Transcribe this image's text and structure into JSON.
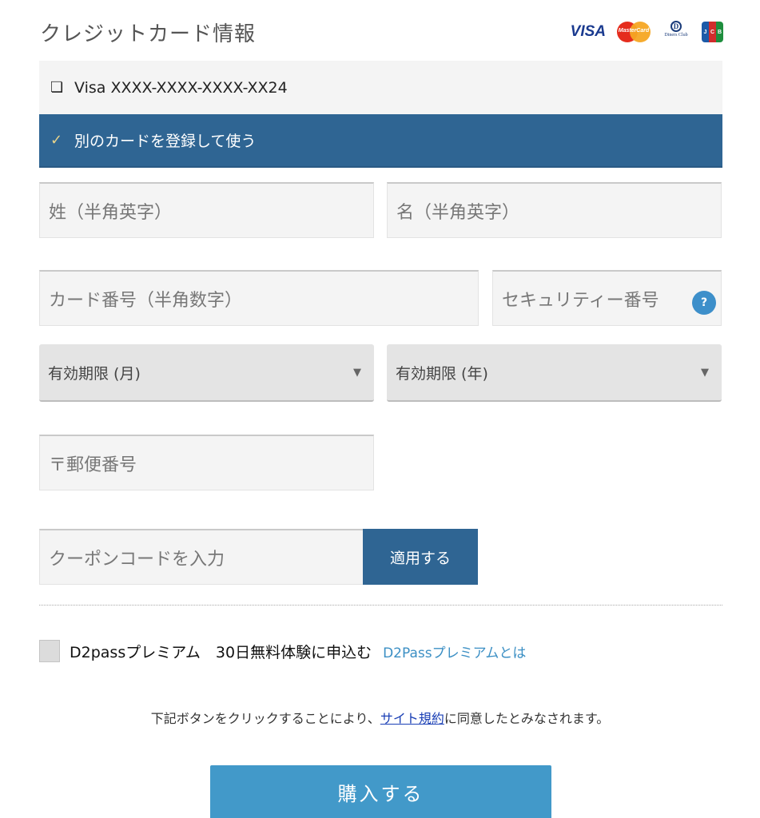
{
  "header": {
    "title": "クレジットカード情報",
    "brands": [
      "VISA",
      "MasterCard",
      "Diners Club International",
      "JCB"
    ]
  },
  "card_options": [
    {
      "icon": "checkbox-icon",
      "label": "Visa XXXX-XXXX-XXXX-XX24",
      "selected": false
    },
    {
      "icon": "checkmark-icon",
      "label": "別のカードを登録して使う",
      "selected": true
    }
  ],
  "form": {
    "last_name_placeholder": "姓（半角英字）",
    "first_name_placeholder": "名（半角英字）",
    "card_number_placeholder": "カード番号（半角数字）",
    "security_code_placeholder": "セキュリティー番号",
    "help_icon": "?",
    "expiry_month_label": "有効期限 (月)",
    "expiry_year_label": "有効期限 (年)",
    "postal_code_placeholder": "〒郵便番号",
    "coupon_placeholder": "クーポンコードを入力",
    "coupon_apply_label": "適用する"
  },
  "premium": {
    "label": "D2passプレミアム　30日無料体験に申込む",
    "link_label": "D2Passプレミアムとは",
    "checked": false
  },
  "agreement": {
    "prefix": "下記ボタンをクリックすることにより、",
    "link_label": "サイト規約",
    "suffix": "に同意したとみなされます。"
  },
  "buy_button_label": "購入する",
  "colors": {
    "primary": "#2f6593",
    "buy_button": "#4299c9",
    "link": "#3b8fc4"
  }
}
